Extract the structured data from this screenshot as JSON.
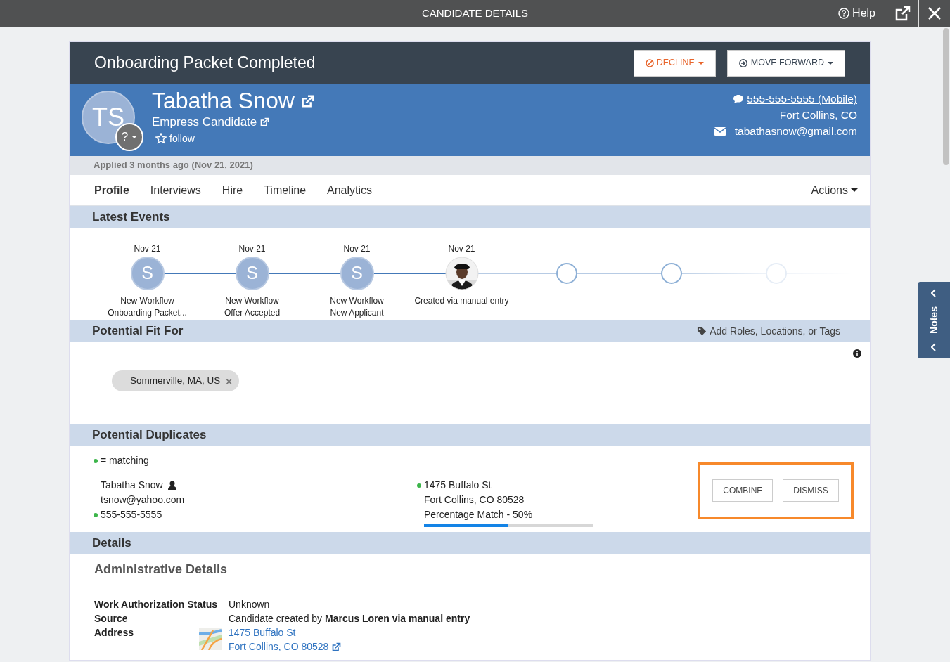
{
  "window": {
    "title": "CANDIDATE DETAILS",
    "help": "Help"
  },
  "status_title": "Onboarding Packet Completed",
  "header_buttons": [
    {
      "label": "DECLINE",
      "kind": "decline"
    },
    {
      "label": "MOVE FORWARD",
      "kind": "forward"
    }
  ],
  "candidate": {
    "initials": "TS",
    "name": "Tabatha Snow",
    "subtitle": "Empress Candidate",
    "badge": "?",
    "follow": "follow",
    "followed": false,
    "phone": "555-555-5555 (Mobile)",
    "location": "Fort Collins, CO",
    "email": "tabathasnow@gmail.com"
  },
  "applied": "Applied 3 months ago (Nov 21, 2021)",
  "tabs": [
    {
      "label": "Profile",
      "selected": true
    },
    {
      "label": "Interviews",
      "selected": false
    },
    {
      "label": "Hire",
      "selected": false
    },
    {
      "label": "Timeline",
      "selected": false
    },
    {
      "label": "Analytics",
      "selected": false
    }
  ],
  "actions": "Actions",
  "latest_events": {
    "title": "Latest Events",
    "events": [
      {
        "kind": "initial",
        "date": "Nov 21",
        "initial": "S",
        "lines": [
          "New Workflow",
          "Onboarding Packet..."
        ]
      },
      {
        "kind": "initial",
        "date": "Nov 21",
        "initial": "S",
        "lines": [
          "New Workflow",
          "Offer Accepted"
        ]
      },
      {
        "kind": "initial",
        "date": "Nov 21",
        "initial": "S",
        "lines": [
          "New Workflow",
          "New Applicant"
        ]
      },
      {
        "date": "Nov 21",
        "lines": [
          "Created via manual entry"
        ]
      },
      {
        "kind": "empty",
        "faded": false
      },
      {
        "kind": "empty",
        "faded": false
      },
      {
        "kind": "empty",
        "faded": true
      }
    ]
  },
  "potential_fit": {
    "title": "Potential Fit For",
    "add_link": "Add Roles, Locations, or Tags",
    "tags": [
      {
        "label": "Sommerville, MA, US",
        "remove": "×"
      }
    ]
  },
  "duplicates": {
    "title": "Potential Duplicates",
    "legend": "= matching",
    "contact": [
      {
        "text": "Tabatha Snow",
        "matching": false,
        "kind": "name"
      },
      {
        "text": "tsnow@yahoo.com",
        "matching": false,
        "kind": "plain"
      },
      {
        "text": "555-555-5555",
        "matching": true,
        "kind": "plain"
      }
    ],
    "address": [
      {
        "text": "1475 Buffalo St",
        "matching": true
      },
      {
        "text": "Fort Collins, CO 80528",
        "matching": false
      }
    ],
    "match": {
      "label": "Percentage Match - 50%",
      "level": 0.5
    },
    "buttons": [
      "COMBINE",
      "DISMISS"
    ],
    "highlighted": true
  },
  "details": {
    "title": "Details",
    "subtitle": "Administrative Details",
    "rows": [
      {
        "kind": "text",
        "label": "Work Authorization Status",
        "value": "Unknown"
      },
      {
        "kind": "text",
        "label": "Source",
        "value": "Candidate created by **Marcus Loren via manual entry**"
      },
      {
        "kind": "address",
        "label": "Address",
        "lines": [
          "1475 Buffalo St",
          "Fort Collins, CO 80528"
        ]
      }
    ]
  },
  "notes": {
    "label": "Notes"
  }
}
